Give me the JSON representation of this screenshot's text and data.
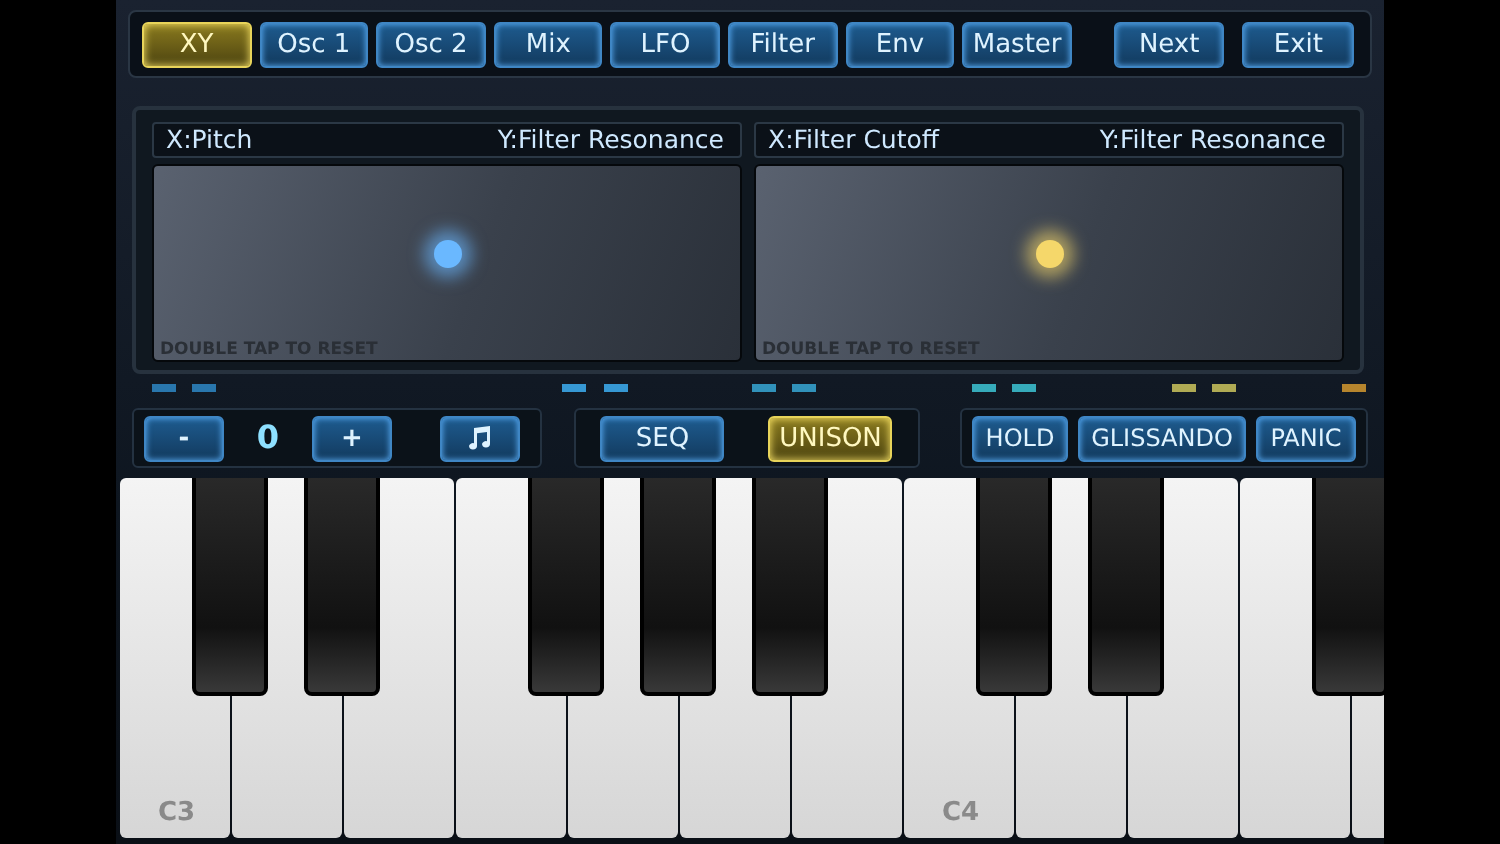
{
  "tabs": [
    {
      "label": "XY",
      "selected": true
    },
    {
      "label": "Osc 1",
      "selected": false
    },
    {
      "label": "Osc 2",
      "selected": false
    },
    {
      "label": "Mix",
      "selected": false
    },
    {
      "label": "LFO",
      "selected": false
    },
    {
      "label": "Filter",
      "selected": false
    },
    {
      "label": "Env",
      "selected": false
    },
    {
      "label": "Master",
      "selected": false
    }
  ],
  "nav_buttons": [
    "Next",
    "Exit"
  ],
  "xy_pads": [
    {
      "x_label": "X:Pitch",
      "y_label": "Y:Filter Resonance",
      "hint": "DOUBLE TAP TO RESET",
      "color": "#6ab8ff"
    },
    {
      "x_label": "X:Filter Cutoff",
      "y_label": "Y:Filter Resonance",
      "hint": "DOUBLE TAP TO RESET",
      "color": "#f5d76a"
    }
  ],
  "octave": {
    "down": "-",
    "value": "0",
    "up": "+"
  },
  "modes": [
    {
      "label": "SEQ",
      "selected": false
    },
    {
      "label": "UNISON",
      "selected": true
    }
  ],
  "actions": [
    "HOLD",
    "GLISSANDO",
    "PANIC"
  ],
  "keys": [
    {
      "kind": "white",
      "label": "C3"
    },
    {
      "kind": "black"
    },
    {
      "kind": "white"
    },
    {
      "kind": "black"
    },
    {
      "kind": "white"
    },
    {
      "kind": "white"
    },
    {
      "kind": "black"
    },
    {
      "kind": "white"
    },
    {
      "kind": "black"
    },
    {
      "kind": "white"
    },
    {
      "kind": "black"
    },
    {
      "kind": "white"
    },
    {
      "kind": "white",
      "label": "C4"
    },
    {
      "kind": "black"
    },
    {
      "kind": "white"
    },
    {
      "kind": "black"
    },
    {
      "kind": "white"
    },
    {
      "kind": "white"
    },
    {
      "kind": "black"
    },
    {
      "kind": "white"
    }
  ]
}
